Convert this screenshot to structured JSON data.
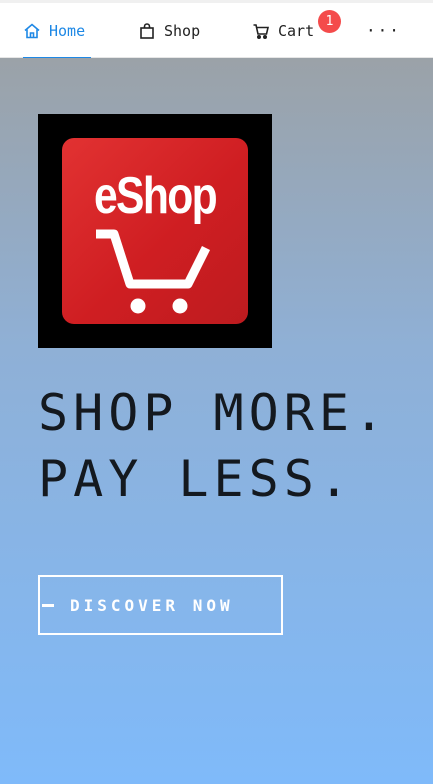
{
  "nav": {
    "items": [
      {
        "label": "Home",
        "icon": "home-icon",
        "active": true
      },
      {
        "label": "Shop",
        "icon": "shopping-bag-icon",
        "active": false
      },
      {
        "label": "Cart",
        "icon": "cart-icon",
        "active": false
      }
    ],
    "more_label": "···",
    "cart_badge": "1",
    "active_color": "#1e88e5",
    "badge_color": "#f44b4b"
  },
  "hero": {
    "logo_text": "eShop",
    "headline_line1": "SHOP MORE.",
    "headline_line2": "PAY LESS.",
    "cta_label": "DISCOVER NOW",
    "gradient_top": "#9ba2a8",
    "gradient_bottom": "#7fbafa"
  }
}
